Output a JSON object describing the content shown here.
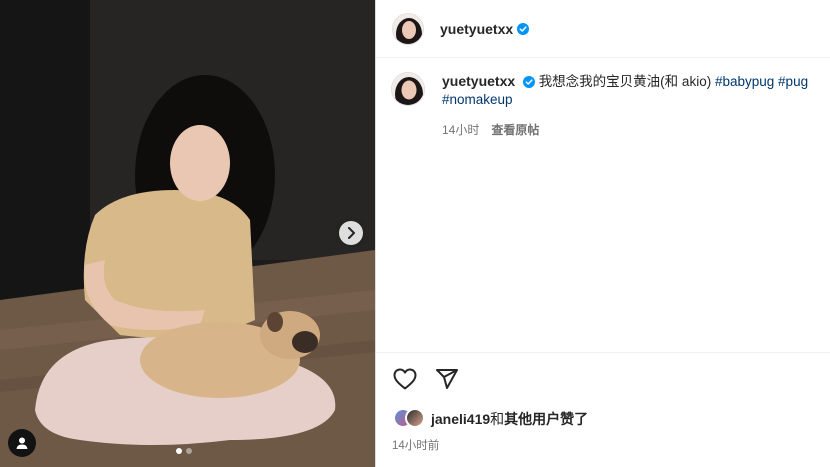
{
  "post": {
    "username": "yuetyuetxx",
    "verified": true,
    "caption_text": "我想念我的宝贝黄油(和 akio)",
    "hashtags": [
      "#babypug",
      "#pug",
      "#nomakeup"
    ],
    "caption_age": "14小时",
    "see_translation": "查看原帖",
    "liked_by_user": "janeli419",
    "liked_by_suffix": "和",
    "liked_by_others": "其他用户赞了",
    "post_age": "14小时前"
  },
  "media": {
    "carousel_total": 2,
    "carousel_index": 1
  },
  "icons": {
    "verified": "verified-badge-icon",
    "next": "chevron-right-icon",
    "user_tag": "user-tag-icon",
    "like": "heart-icon",
    "share": "paper-plane-icon"
  },
  "colors": {
    "verified_blue": "#0095f6",
    "hashtag": "#00376b",
    "muted": "#737373"
  }
}
